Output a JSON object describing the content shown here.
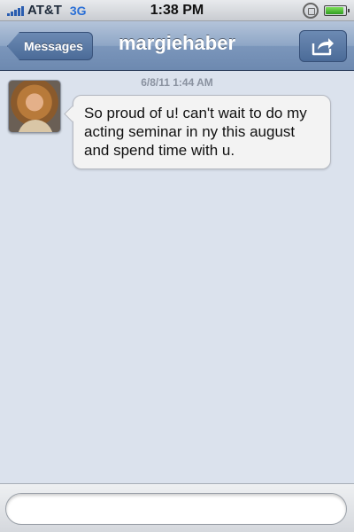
{
  "status_bar": {
    "carrier": "AT&T",
    "network": "3G",
    "time": "1:38 PM",
    "icons": [
      "signal-icon",
      "rotation-lock-icon",
      "battery-icon"
    ],
    "battery_level": 0.9
  },
  "nav": {
    "back_label": "Messages",
    "title": "margiehaber",
    "action_icon": "share-icon"
  },
  "conversation": {
    "timestamp": "6/8/11 1:44 AM",
    "messages": [
      {
        "text": "So proud of u!  can't wait to do my acting seminar in ny this august and spend time with u."
      }
    ]
  },
  "composer": {
    "placeholder": ""
  },
  "colors": {
    "nav_gradient_top": "#b4c4da",
    "nav_gradient_bottom": "#6d89b0",
    "background": "#dbe2ed",
    "bubble": "#f3f3f3"
  }
}
